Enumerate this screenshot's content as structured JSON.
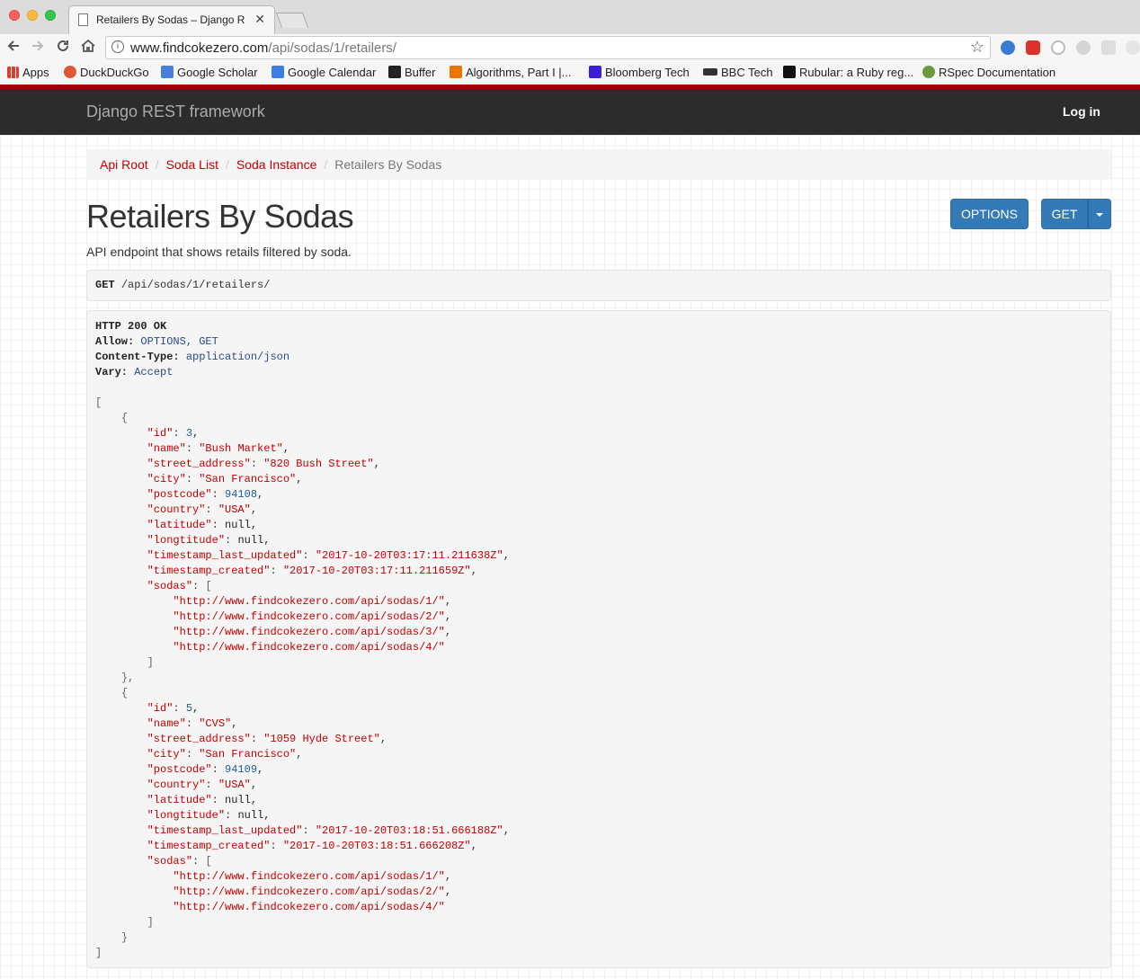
{
  "browser": {
    "tab_title": "Retailers By Sodas – Django R",
    "tab_close": "✕",
    "url_host": "www.findcokezero.com",
    "url_path": "/api/sodas/1/retailers/"
  },
  "bookmarks": [
    {
      "label": "Apps",
      "icon": "apps-grid-icon"
    },
    {
      "label": "DuckDuckGo",
      "icon": "duckduckgo-icon"
    },
    {
      "label": "Google Scholar",
      "icon": "google-scholar-icon"
    },
    {
      "label": "Google Calendar",
      "icon": "google-calendar-icon"
    },
    {
      "label": "Buffer",
      "icon": "buffer-icon"
    },
    {
      "label": "Algorithms, Part I |...",
      "icon": "princeton-icon"
    },
    {
      "label": "Bloomberg Tech",
      "icon": "bloomberg-icon"
    },
    {
      "label": "BBC Tech",
      "icon": "bbc-icon"
    },
    {
      "label": "Rubular: a Ruby reg...",
      "icon": "rubular-icon"
    },
    {
      "label": "RSpec Documentation",
      "icon": "rspec-icon"
    }
  ],
  "navbar": {
    "brand": "Django REST framework",
    "login": "Log in"
  },
  "breadcrumb": {
    "items": [
      "Api Root",
      "Soda List",
      "Soda Instance"
    ],
    "active": "Retailers By Sodas",
    "separator": "/"
  },
  "page": {
    "title": "Retailers By Sodas",
    "description": "API endpoint that shows retails filtered by soda.",
    "options_label": "OPTIONS",
    "get_label": "GET"
  },
  "request": {
    "method": "GET",
    "path": "/api/sodas/1/retailers/"
  },
  "response": {
    "status": "HTTP 200 OK",
    "headers": [
      {
        "key": "Allow:",
        "value": "OPTIONS, GET"
      },
      {
        "key": "Content-Type:",
        "value": "application/json"
      },
      {
        "key": "Vary:",
        "value": "Accept"
      }
    ],
    "retailers": [
      {
        "id": "3",
        "name": "\"Bush Market\"",
        "street_address": "\"820 Bush Street\"",
        "city": "\"San Francisco\"",
        "postcode": "94108",
        "country": "\"USA\"",
        "latitude": "null",
        "longtitude": "null",
        "timestamp_last_updated": "\"2017-10-20T03:17:11.211638Z\"",
        "timestamp_created": "\"2017-10-20T03:17:11.211659Z\"",
        "sodas": [
          "\"http://www.findcokezero.com/api/sodas/1/\"",
          "\"http://www.findcokezero.com/api/sodas/2/\"",
          "\"http://www.findcokezero.com/api/sodas/3/\"",
          "\"http://www.findcokezero.com/api/sodas/4/\""
        ]
      },
      {
        "id": "5",
        "name": "\"CVS\"",
        "street_address": "\"1059 Hyde Street\"",
        "city": "\"San Francisco\"",
        "postcode": "94109",
        "country": "\"USA\"",
        "latitude": "null",
        "longtitude": "null",
        "timestamp_last_updated": "\"2017-10-20T03:18:51.666188Z\"",
        "timestamp_created": "\"2017-10-20T03:18:51.666208Z\"",
        "sodas": [
          "\"http://www.findcokezero.com/api/sodas/1/\"",
          "\"http://www.findcokezero.com/api/sodas/2/\"",
          "\"http://www.findcokezero.com/api/sodas/4/\""
        ]
      }
    ]
  },
  "colors": {
    "accent_red": "#c20000",
    "navbar_bg": "#2c2c2c",
    "button_blue": "#337ab7",
    "header_red_line": "#a30000"
  }
}
